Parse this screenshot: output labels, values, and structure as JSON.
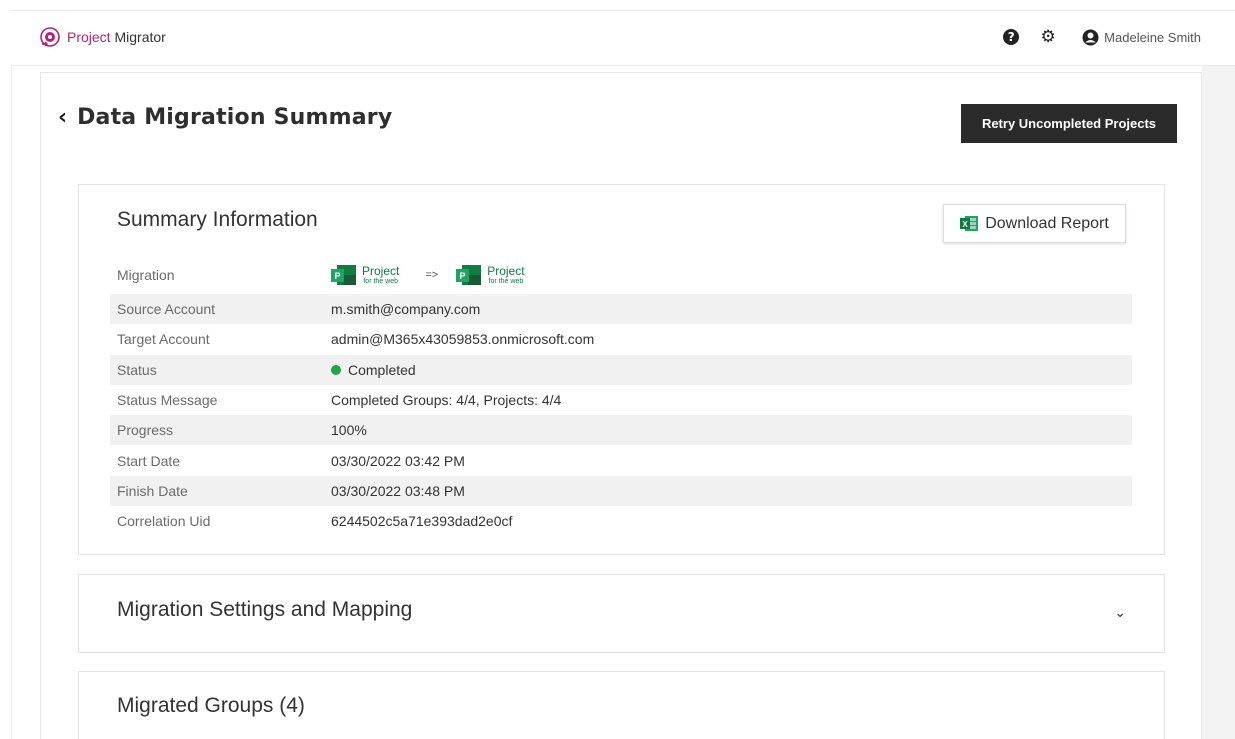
{
  "app": {
    "name_part1": "Project",
    "name_part2": "Migrator",
    "user_name": "Madeleine Smith"
  },
  "page": {
    "title": "Data Migration Summary",
    "retry_button": "Retry Uncompleted Projects"
  },
  "summary": {
    "title": "Summary Information",
    "download_button": "Download Report",
    "migration_label": "Migration",
    "migration_source": {
      "name": "Project",
      "sub": "for the web"
    },
    "migration_arrow": "=>",
    "migration_target": {
      "name": "Project",
      "sub": "for the web"
    },
    "rows": [
      {
        "label": "Source Account",
        "value": "m.smith@company.com"
      },
      {
        "label": "Target Account",
        "value": "admin@M365x43059853.onmicrosoft.com"
      },
      {
        "label": "Status",
        "value": "Completed"
      },
      {
        "label": "Status Message",
        "value": "Completed Groups: 4/4, Projects: 4/4"
      },
      {
        "label": "Progress",
        "value": "100%"
      },
      {
        "label": "Start Date",
        "value": "03/30/2022 03:42 PM"
      },
      {
        "label": "Finish Date",
        "value": "03/30/2022 03:48 PM"
      },
      {
        "label": "Correlation Uid",
        "value": "6244502c5a71e393dad2e0cf"
      }
    ]
  },
  "sections": {
    "settings_title": "Migration Settings and Mapping",
    "groups_title": "Migrated Groups (4)"
  },
  "colors": {
    "brand": "#b4237a",
    "status_completed": "#22a447",
    "project_green": "#107c41",
    "dark_button": "#2b2b2b"
  },
  "icons": {
    "help": "question-circle-icon",
    "settings": "gear-icon",
    "user": "user-circle-icon",
    "back": "chevron-left-icon",
    "excel": "excel-icon",
    "expand": "chevron-down-icon"
  }
}
